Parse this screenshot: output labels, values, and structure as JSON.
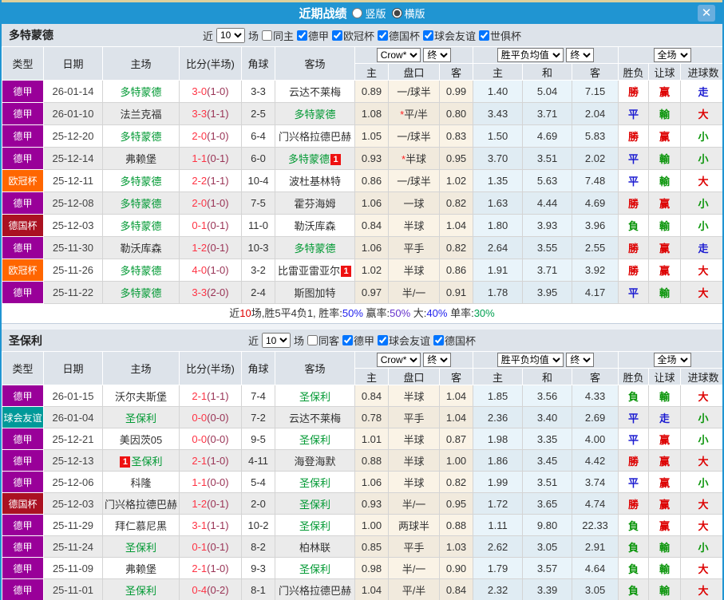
{
  "titlebar": {
    "title": "近期战绩",
    "vertical": "竖版",
    "vertical_checked": false,
    "horizontal": "横版",
    "horizontal_checked": true,
    "close": "✕"
  },
  "cols": {
    "type": "类型",
    "date": "日期",
    "home": "主场",
    "score": "比分(半场)",
    "corner": "角球",
    "away": "客场",
    "crow": "Crow*",
    "final": "终",
    "avg": "胜平负均值",
    "scope": "全场",
    "sub_home": "主",
    "sub_handicap": "盘口",
    "sub_away": "客",
    "sub_avg_home": "主",
    "sub_avg_draw": "和",
    "sub_avg_away": "客",
    "sub_wdl": "胜负",
    "sub_let": "让球",
    "sub_goals": "进球数"
  },
  "comp_colors": {
    "德甲": "#990099",
    "欧冠杯": "#ff6600",
    "德国杯": "#aa1122",
    "球会友谊": "#009999"
  },
  "result_colors": {
    "勝": "#dd0000",
    "赢": "#dd0000",
    "大": "#dd0000",
    "平": "#1b1bd1",
    "走": "#1b1bd1",
    "負": "#089408",
    "輸": "#089408",
    "小": "#089408"
  },
  "sections": [
    {
      "team": "多特蒙德",
      "filters": {
        "near": "近",
        "count": "10",
        "unit": "场",
        "same": {
          "label": "同主",
          "checked": false
        },
        "leagues": [
          {
            "label": "德甲",
            "checked": true
          },
          {
            "label": "欧冠杯",
            "checked": true
          },
          {
            "label": "德国杯",
            "checked": true
          },
          {
            "label": "球会友谊",
            "checked": true
          },
          {
            "label": "世俱杯",
            "checked": true
          }
        ]
      },
      "rows": [
        {
          "comp": "德甲",
          "date": "26-01-14",
          "home": {
            "name": "多特蒙德",
            "focal": true
          },
          "score": "3-0",
          "half": "(1-0)",
          "corner": "3-3",
          "away": {
            "name": "云达不莱梅",
            "focal": false
          },
          "star": false,
          "crow": [
            "0.89",
            "一/球半",
            "0.99"
          ],
          "avg": [
            "1.40",
            "5.04",
            "7.15"
          ],
          "res": [
            "勝",
            "赢",
            "走"
          ]
        },
        {
          "comp": "德甲",
          "date": "26-01-10",
          "home": {
            "name": "法兰克福",
            "focal": false
          },
          "score": "3-3",
          "half": "(1-1)",
          "corner": "2-5",
          "away": {
            "name": "多特蒙德",
            "focal": true
          },
          "star": true,
          "crow": [
            "1.08",
            "平/半",
            "0.80"
          ],
          "avg": [
            "3.43",
            "3.71",
            "2.04"
          ],
          "res": [
            "平",
            "輸",
            "大"
          ]
        },
        {
          "comp": "德甲",
          "date": "25-12-20",
          "home": {
            "name": "多特蒙德",
            "focal": true
          },
          "score": "2-0",
          "half": "(1-0)",
          "corner": "6-4",
          "away": {
            "name": "门兴格拉德巴赫",
            "focal": false
          },
          "star": false,
          "crow": [
            "1.05",
            "一/球半",
            "0.83"
          ],
          "avg": [
            "1.50",
            "4.69",
            "5.83"
          ],
          "res": [
            "勝",
            "赢",
            "小"
          ]
        },
        {
          "comp": "德甲",
          "date": "25-12-14",
          "home": {
            "name": "弗赖堡",
            "focal": false
          },
          "score": "1-1",
          "half": "(0-1)",
          "corner": "6-0",
          "away": {
            "name": "多特蒙德",
            "focal": true,
            "badge": "1",
            "badge_pos": "after"
          },
          "star": true,
          "crow": [
            "0.93",
            "半球",
            "0.95"
          ],
          "avg": [
            "3.70",
            "3.51",
            "2.02"
          ],
          "res": [
            "平",
            "輸",
            "小"
          ]
        },
        {
          "comp": "欧冠杯",
          "date": "25-12-11",
          "home": {
            "name": "多特蒙德",
            "focal": true
          },
          "score": "2-2",
          "half": "(1-1)",
          "corner": "10-4",
          "away": {
            "name": "波杜基林特",
            "focal": false
          },
          "star": false,
          "crow": [
            "0.86",
            "一/球半",
            "1.02"
          ],
          "avg": [
            "1.35",
            "5.63",
            "7.48"
          ],
          "res": [
            "平",
            "輸",
            "大"
          ]
        },
        {
          "comp": "德甲",
          "date": "25-12-08",
          "home": {
            "name": "多特蒙德",
            "focal": true
          },
          "score": "2-0",
          "half": "(1-0)",
          "corner": "7-5",
          "away": {
            "name": "霍芬海姆",
            "focal": false
          },
          "star": false,
          "crow": [
            "1.06",
            "一球",
            "0.82"
          ],
          "avg": [
            "1.63",
            "4.44",
            "4.69"
          ],
          "res": [
            "勝",
            "赢",
            "小"
          ]
        },
        {
          "comp": "德国杯",
          "date": "25-12-03",
          "home": {
            "name": "多特蒙德",
            "focal": true
          },
          "score": "0-1",
          "half": "(0-1)",
          "corner": "11-0",
          "away": {
            "name": "勒沃库森",
            "focal": false
          },
          "star": false,
          "crow": [
            "0.84",
            "半球",
            "1.04"
          ],
          "avg": [
            "1.80",
            "3.93",
            "3.96"
          ],
          "res": [
            "負",
            "輸",
            "小"
          ]
        },
        {
          "comp": "德甲",
          "date": "25-11-30",
          "home": {
            "name": "勒沃库森",
            "focal": false
          },
          "score": "1-2",
          "half": "(0-1)",
          "corner": "10-3",
          "away": {
            "name": "多特蒙德",
            "focal": true
          },
          "star": false,
          "crow": [
            "1.06",
            "平手",
            "0.82"
          ],
          "avg": [
            "2.64",
            "3.55",
            "2.55"
          ],
          "res": [
            "勝",
            "赢",
            "走"
          ]
        },
        {
          "comp": "欧冠杯",
          "date": "25-11-26",
          "home": {
            "name": "多特蒙德",
            "focal": true
          },
          "score": "4-0",
          "half": "(1-0)",
          "corner": "3-2",
          "away": {
            "name": "比雷亚雷亚尔",
            "focal": false,
            "badge": "1",
            "badge_pos": "after"
          },
          "star": false,
          "crow": [
            "1.02",
            "半球",
            "0.86"
          ],
          "avg": [
            "1.91",
            "3.71",
            "3.92"
          ],
          "res": [
            "勝",
            "赢",
            "大"
          ]
        },
        {
          "comp": "德甲",
          "date": "25-11-22",
          "home": {
            "name": "多特蒙德",
            "focal": true
          },
          "score": "3-3",
          "half": "(2-0)",
          "corner": "2-4",
          "away": {
            "name": "斯图加特",
            "focal": false
          },
          "star": false,
          "crow": [
            "0.97",
            "半/一",
            "0.91"
          ],
          "avg": [
            "1.78",
            "3.95",
            "4.17"
          ],
          "res": [
            "平",
            "輸",
            "大"
          ]
        }
      ],
      "summary": [
        {
          "t": "近"
        },
        {
          "t": "10",
          "c": "#e00000"
        },
        {
          "t": "场,胜5平4负1, 胜率:"
        },
        {
          "t": "50%",
          "c": "#2222ee"
        },
        {
          "t": " 赢率:"
        },
        {
          "t": "50%",
          "c": "#6633cc"
        },
        {
          "t": " 大:"
        },
        {
          "t": "40%",
          "c": "#2222ee"
        },
        {
          "t": " 单率:"
        },
        {
          "t": "30%",
          "c": "#00a050"
        }
      ]
    },
    {
      "team": "圣保利",
      "filters": {
        "near": "近",
        "count": "10",
        "unit": "场",
        "same": {
          "label": "同客",
          "checked": false
        },
        "leagues": [
          {
            "label": "德甲",
            "checked": true
          },
          {
            "label": "球会友谊",
            "checked": true
          },
          {
            "label": "德国杯",
            "checked": true
          }
        ]
      },
      "rows": [
        {
          "comp": "德甲",
          "date": "26-01-15",
          "home": {
            "name": "沃尔夫斯堡",
            "focal": false
          },
          "score": "2-1",
          "half": "(1-1)",
          "corner": "7-4",
          "away": {
            "name": "圣保利",
            "focal": true
          },
          "star": false,
          "crow": [
            "0.84",
            "半球",
            "1.04"
          ],
          "avg": [
            "1.85",
            "3.56",
            "4.33"
          ],
          "res": [
            "負",
            "輸",
            "大"
          ]
        },
        {
          "comp": "球会友谊",
          "date": "26-01-04",
          "home": {
            "name": "圣保利",
            "focal": true
          },
          "score": "0-0",
          "half": "(0-0)",
          "corner": "7-2",
          "away": {
            "name": "云达不莱梅",
            "focal": false
          },
          "star": false,
          "crow": [
            "0.78",
            "平手",
            "1.04"
          ],
          "avg": [
            "2.36",
            "3.40",
            "2.69"
          ],
          "res": [
            "平",
            "走",
            "小"
          ]
        },
        {
          "comp": "德甲",
          "date": "25-12-21",
          "home": {
            "name": "美因茨05",
            "focal": false
          },
          "score": "0-0",
          "half": "(0-0)",
          "corner": "9-5",
          "away": {
            "name": "圣保利",
            "focal": true
          },
          "star": false,
          "crow": [
            "1.01",
            "半球",
            "0.87"
          ],
          "avg": [
            "1.98",
            "3.35",
            "4.00"
          ],
          "res": [
            "平",
            "赢",
            "小"
          ]
        },
        {
          "comp": "德甲",
          "date": "25-12-13",
          "home": {
            "name": "圣保利",
            "focal": true,
            "badge": "1",
            "badge_pos": "before"
          },
          "score": "2-1",
          "half": "(1-0)",
          "corner": "4-11",
          "away": {
            "name": "海登海默",
            "focal": false
          },
          "star": false,
          "crow": [
            "0.88",
            "半球",
            "1.00"
          ],
          "avg": [
            "1.86",
            "3.45",
            "4.42"
          ],
          "res": [
            "勝",
            "赢",
            "大"
          ]
        },
        {
          "comp": "德甲",
          "date": "25-12-06",
          "home": {
            "name": "科隆",
            "focal": false
          },
          "score": "1-1",
          "half": "(0-0)",
          "corner": "5-4",
          "away": {
            "name": "圣保利",
            "focal": true
          },
          "star": false,
          "crow": [
            "1.06",
            "半球",
            "0.82"
          ],
          "avg": [
            "1.99",
            "3.51",
            "3.74"
          ],
          "res": [
            "平",
            "赢",
            "小"
          ]
        },
        {
          "comp": "德国杯",
          "date": "25-12-03",
          "home": {
            "name": "门兴格拉德巴赫",
            "focal": false
          },
          "score": "1-2",
          "half": "(0-1)",
          "corner": "2-0",
          "away": {
            "name": "圣保利",
            "focal": true
          },
          "star": false,
          "crow": [
            "0.93",
            "半/一",
            "0.95"
          ],
          "avg": [
            "1.72",
            "3.65",
            "4.74"
          ],
          "res": [
            "勝",
            "赢",
            "大"
          ]
        },
        {
          "comp": "德甲",
          "date": "25-11-29",
          "home": {
            "name": "拜仁慕尼黑",
            "focal": false
          },
          "score": "3-1",
          "half": "(1-1)",
          "corner": "10-2",
          "away": {
            "name": "圣保利",
            "focal": true
          },
          "star": false,
          "crow": [
            "1.00",
            "两球半",
            "0.88"
          ],
          "avg": [
            "1.11",
            "9.80",
            "22.33"
          ],
          "res": [
            "負",
            "赢",
            "大"
          ]
        },
        {
          "comp": "德甲",
          "date": "25-11-24",
          "home": {
            "name": "圣保利",
            "focal": true
          },
          "score": "0-1",
          "half": "(0-1)",
          "corner": "8-2",
          "away": {
            "name": "柏林联",
            "focal": false
          },
          "star": false,
          "crow": [
            "0.85",
            "平手",
            "1.03"
          ],
          "avg": [
            "2.62",
            "3.05",
            "2.91"
          ],
          "res": [
            "負",
            "輸",
            "小"
          ]
        },
        {
          "comp": "德甲",
          "date": "25-11-09",
          "home": {
            "name": "弗赖堡",
            "focal": false
          },
          "score": "2-1",
          "half": "(1-0)",
          "corner": "9-3",
          "away": {
            "name": "圣保利",
            "focal": true
          },
          "star": false,
          "crow": [
            "0.98",
            "半/一",
            "0.90"
          ],
          "avg": [
            "1.79",
            "3.57",
            "4.64"
          ],
          "res": [
            "負",
            "輸",
            "大"
          ]
        },
        {
          "comp": "德甲",
          "date": "25-11-01",
          "home": {
            "name": "圣保利",
            "focal": true
          },
          "score": "0-4",
          "half": "(0-2)",
          "corner": "8-1",
          "away": {
            "name": "门兴格拉德巴赫",
            "focal": false
          },
          "star": false,
          "crow": [
            "1.04",
            "平/半",
            "0.84"
          ],
          "avg": [
            "2.32",
            "3.39",
            "3.05"
          ],
          "res": [
            "負",
            "輸",
            "大"
          ]
        }
      ],
      "summary": null
    }
  ]
}
